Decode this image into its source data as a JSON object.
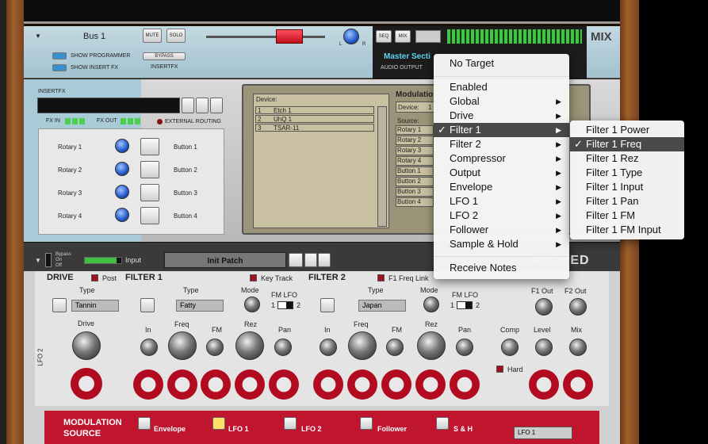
{
  "bus_device": {
    "name": "Bus 1",
    "mute_label": "MUTE",
    "solo_label": "SOLO",
    "show_programmer": "SHOW PROGRAMMER",
    "show_insert_fx": "SHOW INSERT FX",
    "bypass_label": "BYPASS",
    "insertfx_label": "INSERTFX",
    "pan_l": "L",
    "pan_r": "R",
    "seq_label": "SEQ",
    "mix_label": "MIX",
    "master_section": "Master Secti",
    "audio_output": "AUDIO OUTPUT",
    "mix_badge": "MIX"
  },
  "insertfx": {
    "title": "INSERTFX",
    "fx_in": "FX IN",
    "fx_out": "FX OUT",
    "external_routing": "EXTERNAL ROUTING",
    "rotaries": [
      "Rotary 1",
      "Rotary 2",
      "Rotary 3",
      "Rotary 4"
    ],
    "buttons": [
      "Button 1",
      "Button 2",
      "Button 3",
      "Button 4"
    ]
  },
  "modulation_panel": {
    "device_header": "Device:",
    "devices": [
      {
        "num": "1",
        "name": "Etch 1"
      },
      {
        "num": "2",
        "name": "UhQ 1"
      },
      {
        "num": "3",
        "name": "TSAR-11"
      }
    ],
    "title": "Modulatio",
    "device_label": "Device:",
    "device_value": "1",
    "source_label": "Source:",
    "sources": [
      "Rotary 1",
      "Rotary 2",
      "Rotary 3",
      "Rotary 4",
      "Button 1",
      "Button 2",
      "Button 3",
      "Button 4"
    ]
  },
  "synth": {
    "bypass": "Bypass",
    "on": "On",
    "off": "Off",
    "input": "Input",
    "patch": "Init Patch",
    "logo": "NOTRED",
    "drive": {
      "title": "DRIVE",
      "post": "Post",
      "type_label": "Type",
      "type_value": "Tannin",
      "knob": "Drive"
    },
    "filter1": {
      "title": "FILTER 1",
      "key_track": "Key Track",
      "type_label": "Type",
      "type_value": "Fatty",
      "mode": "Mode",
      "fm_lfo": "FM LFO",
      "fm_1": "1",
      "fm_2": "2",
      "knobs": [
        "In",
        "Freq",
        "FM",
        "Rez",
        "Pan"
      ]
    },
    "filter2": {
      "title": "FILTER 2",
      "f1_freq_link": "F1 Freq Link",
      "type_label": "Type",
      "type_value": "Japan",
      "mode": "Mode",
      "fm_lfo": "FM LFO",
      "fm_1": "1",
      "fm_2": "2",
      "knobs": [
        "In",
        "Freq",
        "FM",
        "Rez",
        "Pan"
      ]
    },
    "output": {
      "f1_out": "F1 Out",
      "f2_out": "F2 Out",
      "comp": "Comp",
      "level": "Level",
      "mix": "Mix",
      "hard": "Hard"
    },
    "side_label": "LFO 2",
    "mod_source": "MODULATION SOURCE",
    "mod_tabs": [
      "Envelope",
      "LFO 1",
      "LFO 2",
      "Follower",
      "S & H"
    ],
    "mod_dest": "LFO 1"
  },
  "context_menu": {
    "items": [
      {
        "label": "No Target",
        "submenu": false
      },
      {
        "label": "Enabled",
        "submenu": false
      },
      {
        "label": "Global",
        "submenu": true
      },
      {
        "label": "Drive",
        "submenu": true
      },
      {
        "label": "Filter 1",
        "submenu": true,
        "checked": true,
        "selected": true
      },
      {
        "label": "Filter 2",
        "submenu": true
      },
      {
        "label": "Compressor",
        "submenu": true
      },
      {
        "label": "Output",
        "submenu": true
      },
      {
        "label": "Envelope",
        "submenu": true
      },
      {
        "label": "LFO 1",
        "submenu": true
      },
      {
        "label": "LFO 2",
        "submenu": true
      },
      {
        "label": "Follower",
        "submenu": true
      },
      {
        "label": "Sample & Hold",
        "submenu": true
      },
      {
        "label": "Receive Notes",
        "submenu": false
      }
    ],
    "check": "✓",
    "arrow": "▶"
  },
  "submenu": {
    "items": [
      "Filter 1 Power",
      "Filter 1 Freq",
      "Filter 1 Rez",
      "Filter 1 Type",
      "Filter 1 Input",
      "Filter 1 Pan",
      "Filter 1 FM",
      "Filter 1 FM Input"
    ],
    "selected_index": 1
  },
  "colors": {
    "accent_red": "#c0152e",
    "menu_highlight": "#4a4a4a",
    "bus_blue": "#a9cbd8"
  }
}
